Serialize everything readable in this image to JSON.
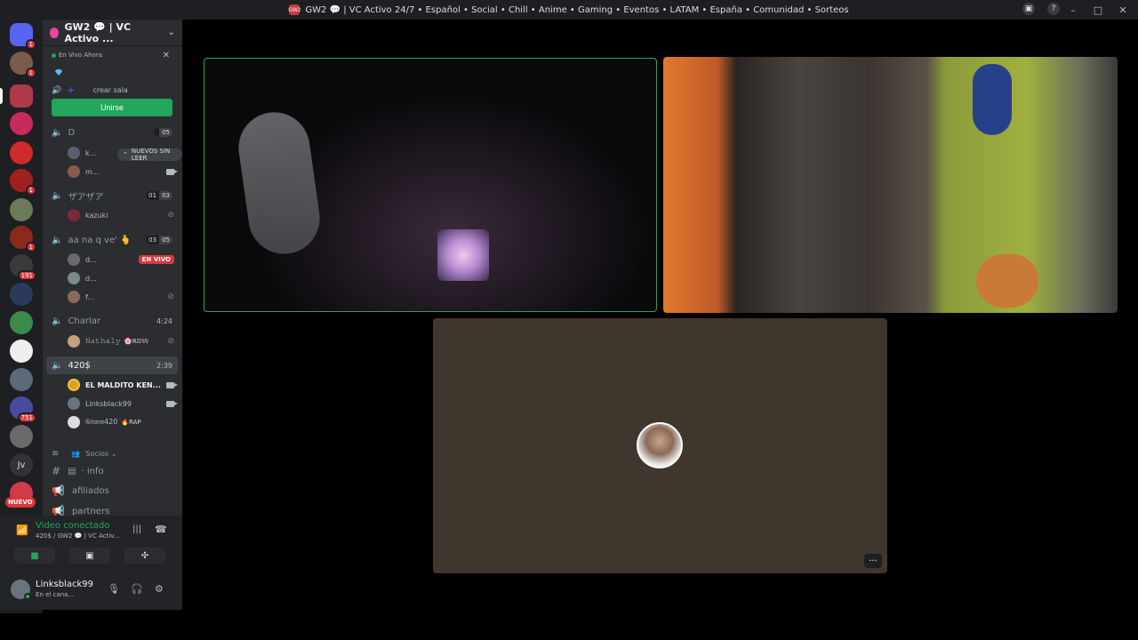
{
  "window": {
    "title": "GW2 💬 | VC Activo 24/7 • Español • Social • Chill • Anime • Gaming • Eventos • LATAM • España • Comunidad • Sorteos",
    "server_icon_text": "GW2"
  },
  "guilds": {
    "badges": [
      "1",
      "1",
      "1",
      "1",
      "1",
      "191",
      "751"
    ],
    "initials": "Jv",
    "nuevo": "NUEVO"
  },
  "server": {
    "name": "GW2 💬 | VC Activo ...",
    "live_now": "En Vivo Ahora",
    "create_room": "crear sala",
    "join_button": "Unirse",
    "unread_banner": "NUEVOS SIN LEER"
  },
  "channels": [
    {
      "name": "D",
      "count_a": "",
      "count_b": "05",
      "users": [
        {
          "name": "k...",
          "icon": "camera"
        },
        {
          "name": "m...",
          "icon": "camera"
        }
      ]
    },
    {
      "name": "ザアザア",
      "count_a": "01",
      "count_b": "03",
      "users": [
        {
          "name": "kazuki",
          "icon": "muted"
        }
      ]
    },
    {
      "name": "aa na q ve' 🫰",
      "count_a": "03",
      "count_b": "05",
      "users": [
        {
          "name": "d...",
          "icon": "live"
        },
        {
          "name": "d...",
          "icon": ""
        },
        {
          "name": "f...",
          "icon": "muted"
        }
      ]
    },
    {
      "name": "Charlar",
      "time": "4:24",
      "users": [
        {
          "name": "𝙽𝚊𝚝𝚑𝚊𝚕𝚢",
          "tag": "🌸ℝ𝔻𝕎",
          "icon": "muted"
        }
      ]
    },
    {
      "name": "420$",
      "time": "2:39",
      "users": [
        {
          "name": "EL MALDITO KEN...",
          "icon": "camera"
        },
        {
          "name": "Linksblack99",
          "icon": "camera"
        },
        {
          "name": "𝔊𝔦𝔱𝔞𝔫𝔬420",
          "tag": "🔥RAP",
          "icon": ""
        }
      ]
    }
  ],
  "live_label": "EN VIVO",
  "category": {
    "name": "Socios"
  },
  "text_channels": [
    {
      "name": "· info"
    },
    {
      "name": "afiliados"
    },
    {
      "name": "partners"
    }
  ],
  "voice": {
    "title": "Video conectado",
    "subtitle": "420$ / GW2 💬 | VC Activ..."
  },
  "user": {
    "name": "Linksblack99",
    "status": "En el cana..."
  },
  "more_label": "···"
}
